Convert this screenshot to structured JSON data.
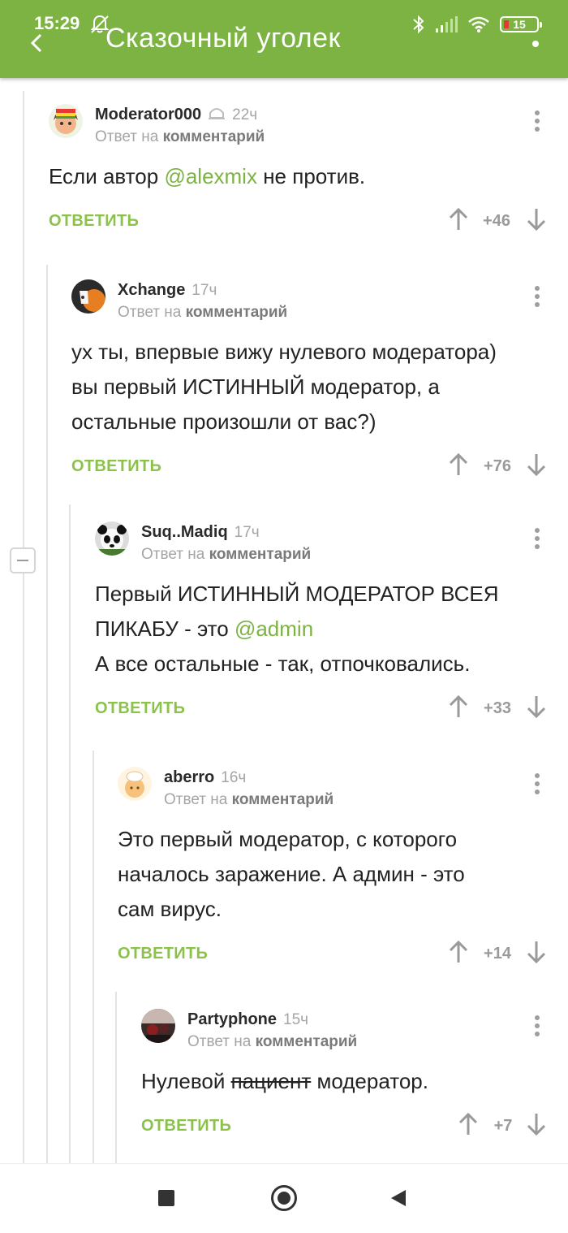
{
  "status_bar": {
    "time": "15:29",
    "battery": "15"
  },
  "app_bar": {
    "title": "Сказочный уголек"
  },
  "comments": [
    {
      "author": "Moderator000",
      "time": "22ч",
      "reply_prefix": "Ответ на",
      "reply_link": "комментарий",
      "body": [
        [
          {
            "t": "Если автор "
          },
          {
            "t": "@alexmix",
            "mention": true
          },
          {
            "t": " не против."
          }
        ]
      ],
      "reply_label": "ОТВЕТИТЬ",
      "score": "+46"
    },
    {
      "author": "Xchange",
      "time": "17ч",
      "reply_prefix": "Ответ на",
      "reply_link": "комментарий",
      "body": [
        [
          {
            "t": "ух ты, впервые вижу нулевого модератора)"
          }
        ],
        [
          {
            "t": "вы первый ИСТИННЫЙ модератор, а"
          }
        ],
        [
          {
            "t": "остальные произошли от вас?)"
          }
        ]
      ],
      "reply_label": "ОТВЕТИТЬ",
      "score": "+76"
    },
    {
      "author": "Suq..Madiq",
      "time": "17ч",
      "reply_prefix": "Ответ на",
      "reply_link": "комментарий",
      "body": [
        [
          {
            "t": "Первый ИСТИННЫЙ МОДЕРАТОР ВСЕЯ"
          }
        ],
        [
          {
            "t": "ПИКАБУ - это "
          },
          {
            "t": "@admin",
            "mention": true
          }
        ],
        [
          {
            "t": "А все остальные - так, отпочковались."
          }
        ]
      ],
      "reply_label": "ОТВЕТИТЬ",
      "score": "+33"
    },
    {
      "author": "aberro",
      "time": "16ч",
      "reply_prefix": "Ответ на",
      "reply_link": "комментарий",
      "body": [
        [
          {
            "t": "Это первый модератор, с которого"
          }
        ],
        [
          {
            "t": "началось заражение. А админ - это"
          }
        ],
        [
          {
            "t": "сам вирус."
          }
        ]
      ],
      "reply_label": "ОТВЕТИТЬ",
      "score": "+14"
    },
    {
      "author": "Partyphone",
      "time": "15ч",
      "reply_prefix": "Ответ на",
      "reply_link": "комментарий",
      "body": [
        [
          {
            "t": "Нулевой "
          },
          {
            "t": "пациент",
            "strike": true
          },
          {
            "t": " модератор."
          }
        ]
      ],
      "reply_label": "ОТВЕТИТЬ",
      "score": "+7"
    }
  ],
  "icons": {
    "status": [
      "dnd-icon",
      "bluetooth-icon",
      "signal-icon",
      "wifi-icon",
      "battery-icon"
    ],
    "appbar": [
      "back-arrow-icon",
      "overflow-menu-icon"
    ],
    "comment": [
      "more-vert-icon",
      "arrow-up-icon",
      "arrow-down-icon"
    ],
    "nav": [
      "recents-square-icon",
      "home-circle-icon",
      "back-triangle-icon"
    ]
  },
  "colors": {
    "accent": "#7cb342",
    "reply_text": "#8bc34a",
    "muted": "#a5a5a5"
  }
}
